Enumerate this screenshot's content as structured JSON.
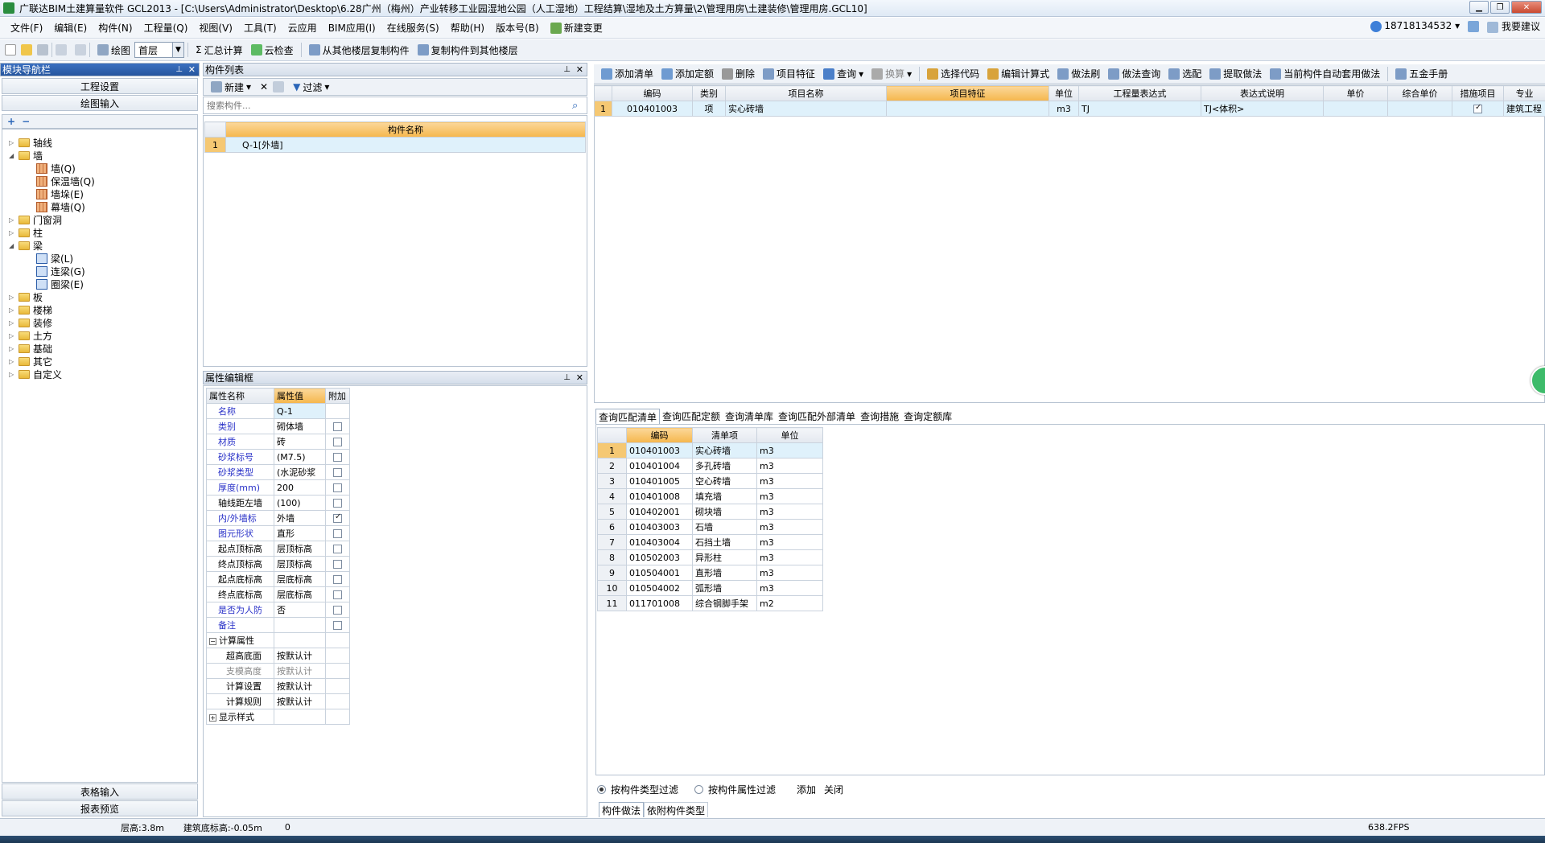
{
  "window": {
    "title": "广联达BIM土建算量软件 GCL2013 - [C:\\Users\\Administrator\\Desktop\\6.28广州（梅州）产业转移工业园湿地公园（人工湿地）工程结算\\湿地及土方算量\\2\\管理用房\\土建装修\\管理用房.GCL10]"
  },
  "menu": {
    "items": [
      "文件(F)",
      "编辑(E)",
      "构件(N)",
      "工程量(Q)",
      "视图(V)",
      "工具(T)",
      "云应用",
      "BIM应用(I)",
      "在线服务(S)",
      "帮助(H)",
      "版本号(B)",
      "新建变更"
    ],
    "user": "18718134532",
    "suggest": "我要建议"
  },
  "toolbar": {
    "draw": "绘图",
    "floor": "首层",
    "sum": "汇总计算",
    "cloud_check": "云检查",
    "copy_from": "从其他楼层复制构件",
    "copy_to": "复制构件到其他楼层"
  },
  "nav": {
    "title": "模块导航栏",
    "project_settings": "工程设置",
    "draw_input": "绘图输入",
    "table_input": "表格输入",
    "report_preview": "报表预览",
    "tree": [
      {
        "label": "轴线",
        "level": 0,
        "toggle": "▷",
        "icon": "folder"
      },
      {
        "label": "墙",
        "level": 0,
        "toggle": "◢",
        "icon": "folder"
      },
      {
        "label": "墙(Q)",
        "level": 1,
        "icon": "wall"
      },
      {
        "label": "保温墙(Q)",
        "level": 1,
        "icon": "wall"
      },
      {
        "label": "墙垛(E)",
        "level": 1,
        "icon": "wall"
      },
      {
        "label": "幕墙(Q)",
        "level": 1,
        "icon": "wall"
      },
      {
        "label": "门窗洞",
        "level": 0,
        "toggle": "▷",
        "icon": "folder"
      },
      {
        "label": "柱",
        "level": 0,
        "toggle": "▷",
        "icon": "folder"
      },
      {
        "label": "梁",
        "level": 0,
        "toggle": "◢",
        "icon": "folder"
      },
      {
        "label": "梁(L)",
        "level": 1,
        "icon": "beam"
      },
      {
        "label": "连梁(G)",
        "level": 1,
        "icon": "beam"
      },
      {
        "label": "圈梁(E)",
        "level": 1,
        "icon": "beam"
      },
      {
        "label": "板",
        "level": 0,
        "toggle": "▷",
        "icon": "folder"
      },
      {
        "label": "楼梯",
        "level": 0,
        "toggle": "▷",
        "icon": "folder"
      },
      {
        "label": "装修",
        "level": 0,
        "toggle": "▷",
        "icon": "folder"
      },
      {
        "label": "土方",
        "level": 0,
        "toggle": "▷",
        "icon": "folder"
      },
      {
        "label": "基础",
        "level": 0,
        "toggle": "▷",
        "icon": "folder"
      },
      {
        "label": "其它",
        "level": 0,
        "toggle": "▷",
        "icon": "folder"
      },
      {
        "label": "自定义",
        "level": 0,
        "toggle": "▷",
        "icon": "folder"
      }
    ]
  },
  "component_list": {
    "title": "构件列表",
    "new": "新建",
    "filter": "过滤",
    "search_placeholder": "搜索构件...",
    "column": "构件名称",
    "rows": [
      {
        "no": "1",
        "name": "Q-1[外墙]"
      }
    ]
  },
  "props": {
    "title": "属性编辑框",
    "headers": [
      "属性名称",
      "属性值",
      "附加"
    ],
    "rows": [
      {
        "name": "名称",
        "value": "Q-1",
        "blue": true,
        "cb": null
      },
      {
        "name": "类别",
        "value": "砌体墙",
        "blue": true,
        "cb": false
      },
      {
        "name": "材质",
        "value": "砖",
        "blue": true,
        "cb": false
      },
      {
        "name": "砂浆标号",
        "value": "(M7.5)",
        "blue": true,
        "cb": false
      },
      {
        "name": "砂浆类型",
        "value": "(水泥砂浆",
        "blue": true,
        "cb": false
      },
      {
        "name": "厚度(mm)",
        "value": "200",
        "blue": true,
        "cb": false
      },
      {
        "name": "轴线距左墙",
        "value": "(100)",
        "blue": false,
        "cb": false
      },
      {
        "name": "内/外墙标",
        "value": "外墙",
        "blue": true,
        "cb": true
      },
      {
        "name": "图元形状",
        "value": "直形",
        "blue": true,
        "cb": false
      },
      {
        "name": "起点顶标高",
        "value": "层顶标高",
        "blue": false,
        "cb": false
      },
      {
        "name": "终点顶标高",
        "value": "层顶标高",
        "blue": false,
        "cb": false
      },
      {
        "name": "起点底标高",
        "value": "层底标高",
        "blue": false,
        "cb": false
      },
      {
        "name": "终点底标高",
        "value": "层底标高",
        "blue": false,
        "cb": false
      },
      {
        "name": "是否为人防",
        "value": "否",
        "blue": true,
        "cb": false
      },
      {
        "name": "备注",
        "value": "",
        "blue": true,
        "cb": false
      }
    ],
    "group_calc": "计算属性",
    "calc_rows": [
      {
        "name": "超高底面",
        "value": "按默认计"
      },
      {
        "name": "支模高度",
        "value": "按默认计"
      },
      {
        "name": "计算设置",
        "value": "按默认计"
      },
      {
        "name": "计算规则",
        "value": "按默认计"
      }
    ],
    "group_display": "显示样式"
  },
  "right_toolbar": [
    "添加清单",
    "添加定额",
    "删除",
    "项目特征",
    "查询",
    "换算",
    "选择代码",
    "编辑计算式",
    "做法刷",
    "做法查询",
    "选配",
    "提取做法",
    "当前构件自动套用做法",
    "五金手册"
  ],
  "bill": {
    "headers": [
      "编码",
      "类别",
      "项目名称",
      "项目特征",
      "单位",
      "工程量表达式",
      "表达式说明",
      "单价",
      "综合单价",
      "措施项目",
      "专业"
    ],
    "rows": [
      {
        "no": "1",
        "code": "010401003",
        "type": "项",
        "name": "实心砖墙",
        "feature": "",
        "unit": "m3",
        "expr": "TJ",
        "desc": "TJ<体积>",
        "price": "",
        "total": "",
        "measure": true,
        "major": "建筑工程"
      }
    ]
  },
  "query": {
    "tabs": [
      "查询匹配清单",
      "查询匹配定额",
      "查询清单库",
      "查询匹配外部清单",
      "查询措施",
      "查询定额库"
    ],
    "headers": [
      "编码",
      "清单项",
      "单位"
    ],
    "rows": [
      {
        "no": "1",
        "code": "010401003",
        "name": "实心砖墙",
        "unit": "m3"
      },
      {
        "no": "2",
        "code": "010401004",
        "name": "多孔砖墙",
        "unit": "m3"
      },
      {
        "no": "3",
        "code": "010401005",
        "name": "空心砖墙",
        "unit": "m3"
      },
      {
        "no": "4",
        "code": "010401008",
        "name": "填充墙",
        "unit": "m3"
      },
      {
        "no": "5",
        "code": "010402001",
        "name": "砌块墙",
        "unit": "m3"
      },
      {
        "no": "6",
        "code": "010403003",
        "name": "石墙",
        "unit": "m3"
      },
      {
        "no": "7",
        "code": "010403004",
        "name": "石挡土墙",
        "unit": "m3"
      },
      {
        "no": "8",
        "code": "010502003",
        "name": "异形柱",
        "unit": "m3"
      },
      {
        "no": "9",
        "code": "010504001",
        "name": "直形墙",
        "unit": "m3"
      },
      {
        "no": "10",
        "code": "010504002",
        "name": "弧形墙",
        "unit": "m3"
      },
      {
        "no": "11",
        "code": "011701008",
        "name": "综合钢脚手架",
        "unit": "m2"
      }
    ],
    "filter_type": "按构件类型过滤",
    "filter_prop": "按构件属性过滤",
    "add": "添加",
    "close": "关闭",
    "bottom_tabs": [
      "构件做法",
      "依附构件类型"
    ]
  },
  "status": {
    "floor_height": "层高:3.8m",
    "base_elev": "建筑底标高:-0.05m",
    "zero": "0",
    "fps": "638.2FPS"
  },
  "colors": {
    "accent": "#f5b64c",
    "nav_head": "#2b5ca6",
    "selected_row": "#dff1fb"
  }
}
